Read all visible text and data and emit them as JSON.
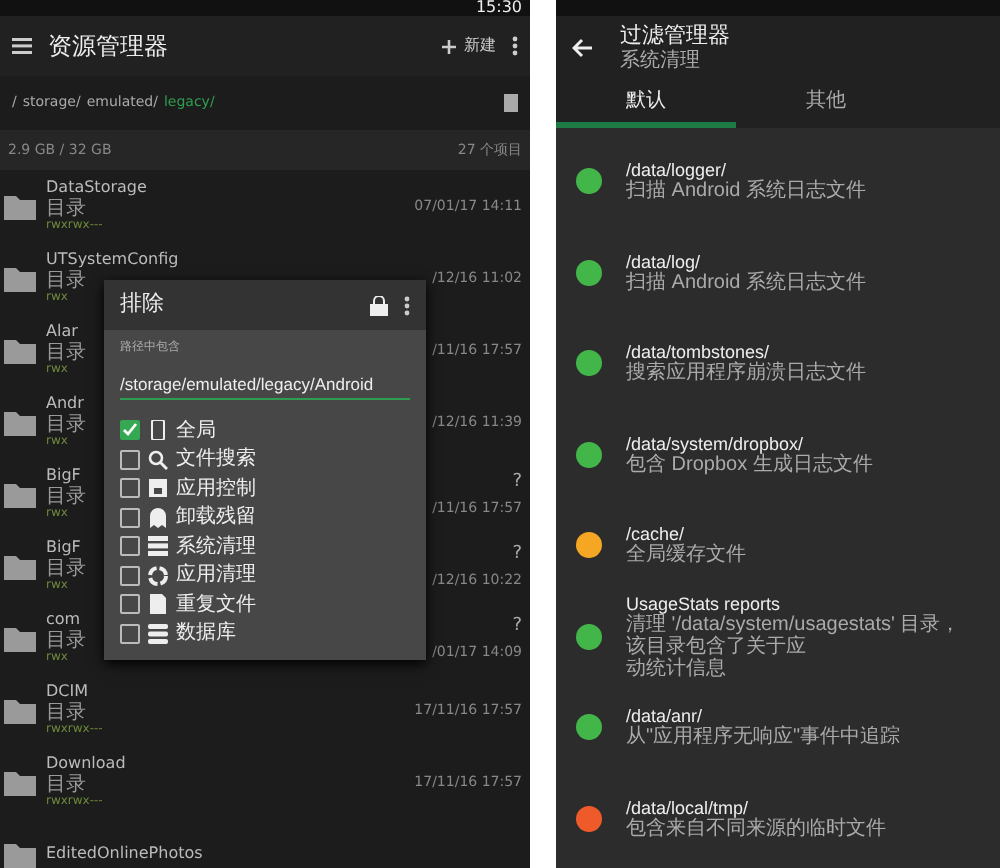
{
  "explorer": {
    "status_time": "15:30",
    "title": "资源管理器",
    "new_label": "新建",
    "path": [
      {
        "text": "/",
        "current": false
      },
      {
        "text": "storage/",
        "current": false
      },
      {
        "text": "emulated/",
        "current": false
      },
      {
        "text": "legacy/",
        "current": true
      }
    ],
    "storage": "2.9 GB / 32 GB",
    "count": "27 个项目",
    "rows": [
      {
        "name": "DataStorage",
        "type": "目录",
        "perm": "rwxrwx---",
        "date": "07/01/17 14:11"
      },
      {
        "name": "UTSystemConfig",
        "type": "目录",
        "perm": "rwx",
        "date": "/12/16 11:02"
      },
      {
        "name": "Alar",
        "type": "目录",
        "perm": "rwx",
        "date": "/11/16 17:57"
      },
      {
        "name": "Andr",
        "type": "目录",
        "perm": "rwx",
        "date": "/12/16 11:39"
      },
      {
        "name": "BigF",
        "type": "目录",
        "perm": "rwx",
        "date": "/11/16 17:57",
        "flag": "?"
      },
      {
        "name": "BigF",
        "type": "目录",
        "perm": "rwx",
        "date": "/12/16 10:22",
        "flag": "?"
      },
      {
        "name": "com",
        "type": "目录",
        "perm": "rwx",
        "date": "/01/17 14:09",
        "flag": "?"
      },
      {
        "name": "DCIM",
        "type": "目录",
        "perm": "rwxrwx---",
        "date": "17/11/16 17:57"
      },
      {
        "name": "Download",
        "type": "目录",
        "perm": "rwxrwx---",
        "date": "17/11/16 17:57"
      },
      {
        "name": "EditedOnlinePhotos"
      }
    ],
    "dialog": {
      "title": "排除",
      "field_label": "路径中包含",
      "field_value": "/storage/emulated/legacy/Android",
      "options": [
        {
          "label": "全局",
          "checked": true
        },
        {
          "label": "文件搜索",
          "checked": false
        },
        {
          "label": "应用控制",
          "checked": false
        },
        {
          "label": "卸载残留",
          "checked": false
        },
        {
          "label": "系统清理",
          "checked": false
        },
        {
          "label": "应用清理",
          "checked": false
        },
        {
          "label": "重复文件",
          "checked": false
        },
        {
          "label": "数据库",
          "checked": false
        }
      ]
    }
  },
  "filters": {
    "title": "过滤管理器",
    "subtitle": "系统清理",
    "tabs": [
      {
        "label": "默认",
        "selected": true
      },
      {
        "label": "其他",
        "selected": false
      }
    ],
    "items": [
      {
        "path": "/data/logger/",
        "desc": [
          "扫描 Android 系统日志文件"
        ],
        "color": "#43b649"
      },
      {
        "path": "/data/log/",
        "desc": [
          "扫描 Android 系统日志文件"
        ],
        "color": "#43b649"
      },
      {
        "path": "/data/tombstones/",
        "desc": [
          "搜索应用程序崩溃日志文件"
        ],
        "color": "#43b649"
      },
      {
        "path": "/data/system/dropbox/",
        "desc": [
          "包含 Dropbox 生成日志文件"
        ],
        "color": "#43b649"
      },
      {
        "path": "/cache/",
        "desc": [
          "全局缓存文件"
        ],
        "color": "#f5a623"
      },
      {
        "path": "UsageStats reports",
        "desc": [
          "清理 '/data/system/usagestats' 目录，该目录包含了关于应",
          "动统计信息"
        ],
        "color": "#43b649"
      },
      {
        "path": "/data/anr/",
        "desc": [
          "从\"应用程序无响应\"事件中追踪"
        ],
        "color": "#43b649"
      },
      {
        "path": "/data/local/tmp/",
        "desc": [
          "包含来自不同来源的临时文件"
        ],
        "color": "#ef5a2b"
      }
    ]
  }
}
